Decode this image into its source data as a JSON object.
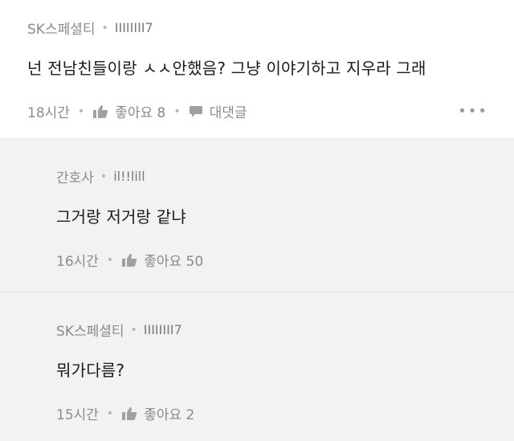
{
  "main_comment": {
    "author": "SK스페셜티",
    "user_id": "IIIIIIII7",
    "body": "넌 전남친들이랑 ㅅㅅ안했음? 그냥 이야기하고 지우라 그래",
    "time": "18시간",
    "like_label": "좋아요 8",
    "reply_label": "대댓글",
    "more": "•••"
  },
  "replies": [
    {
      "author": "간호사",
      "user_id": "il!!lill",
      "body": "그거랑 저거랑 같냐",
      "time": "16시간",
      "like_label": "좋아요 50"
    },
    {
      "author": "SK스페셜티",
      "user_id": "IIIIIIII7",
      "body": "뭐가다름?",
      "time": "15시간",
      "like_label": "좋아요 2"
    }
  ],
  "separator": "•",
  "icons": {
    "like": "thumbs-up-icon",
    "reply": "speech-bubble-icon",
    "more": "more-dots-icon"
  },
  "colors": {
    "reply_background": "#f2f2f2",
    "meta_text": "#8a8a8a",
    "body_text": "#1a1a1a"
  }
}
